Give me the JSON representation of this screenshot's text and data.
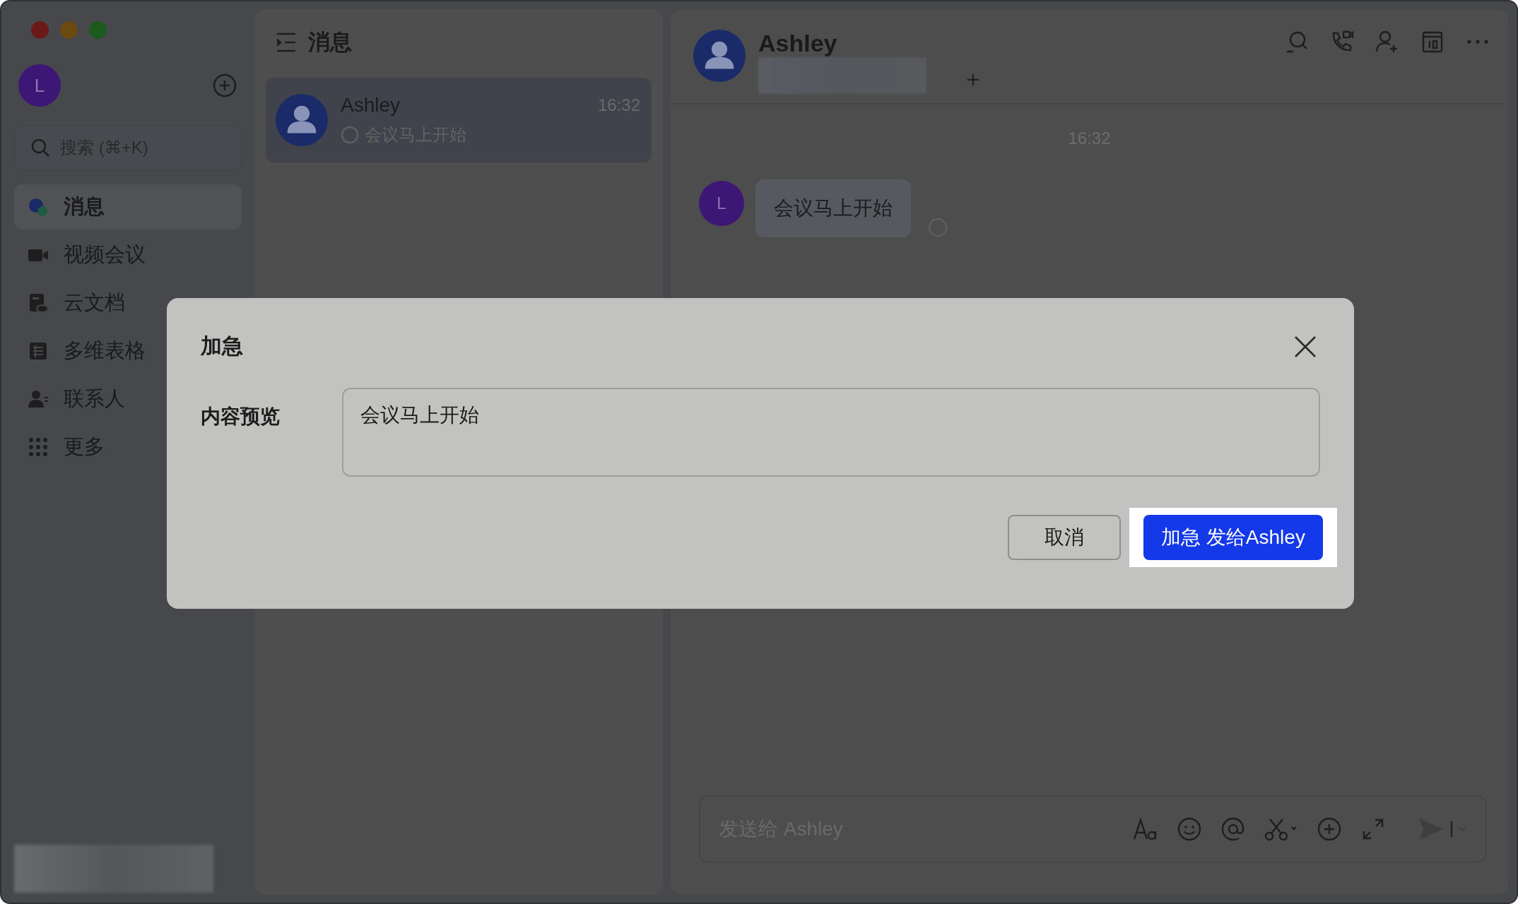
{
  "sidebar": {
    "avatar_letter": "L",
    "search": {
      "placeholder": "搜索 (⌘+K)"
    },
    "nav": [
      {
        "label": "消息",
        "kind": "chat",
        "selected": true
      },
      {
        "label": "视频会议",
        "kind": "video",
        "selected": false
      },
      {
        "label": "云文档",
        "kind": "docs",
        "selected": false
      },
      {
        "label": "多维表格",
        "kind": "table",
        "selected": false
      },
      {
        "label": "联系人",
        "kind": "contacts",
        "selected": false
      },
      {
        "label": "更多",
        "kind": "more",
        "selected": false
      }
    ]
  },
  "chat_list": {
    "title": "消息",
    "chats": [
      {
        "name": "Ashley",
        "time": "16:32",
        "preview": "会议马上开始",
        "selected": true
      }
    ]
  },
  "chat": {
    "title": "Ashley",
    "plus": "+",
    "time_divider": "16:32",
    "messages": [
      {
        "avatar_letter": "L",
        "text": "会议马上开始"
      }
    ],
    "composer": {
      "placeholder": "发送给 Ashley"
    }
  },
  "dialog": {
    "title": "加急",
    "field_label": "内容预览",
    "field_value": "会议马上开始",
    "buttons": [
      {
        "label": "取消",
        "kind": "secondary",
        "highlighted": false
      },
      {
        "label": "加急 发给Ashley",
        "kind": "primary",
        "highlighted": true
      }
    ]
  }
}
